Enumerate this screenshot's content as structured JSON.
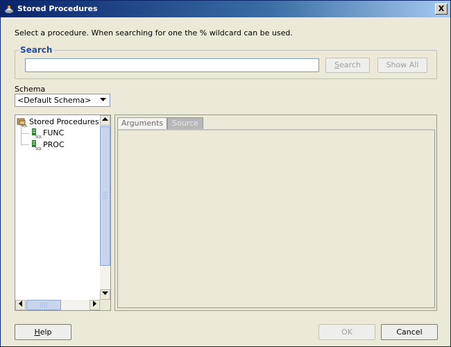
{
  "window": {
    "title": "Stored Procedures",
    "close_glyph": "X"
  },
  "instructions": "Select a procedure. When searching for one the % wildcard can be used.",
  "search": {
    "group_label": "Search",
    "input_value": "",
    "search_button": "Search",
    "show_all_button": "Show All"
  },
  "schema": {
    "label": "Schema",
    "selected": "<Default Schema>"
  },
  "tree": {
    "root_label": "Stored Procedures",
    "items": [
      {
        "label": "FUNC",
        "icon": "sql-procedure-icon"
      },
      {
        "label": "PROC",
        "icon": "sql-procedure-icon"
      }
    ]
  },
  "tabs": [
    {
      "label": "Arguments",
      "active": true
    },
    {
      "label": "Source",
      "active": false
    }
  ],
  "footer": {
    "help": "Help",
    "ok": "OK",
    "cancel": "Cancel"
  },
  "colors": {
    "title_bar": "#0a246a",
    "dialog_bg": "#ece9d8",
    "search_label": "#2b4e9a"
  }
}
